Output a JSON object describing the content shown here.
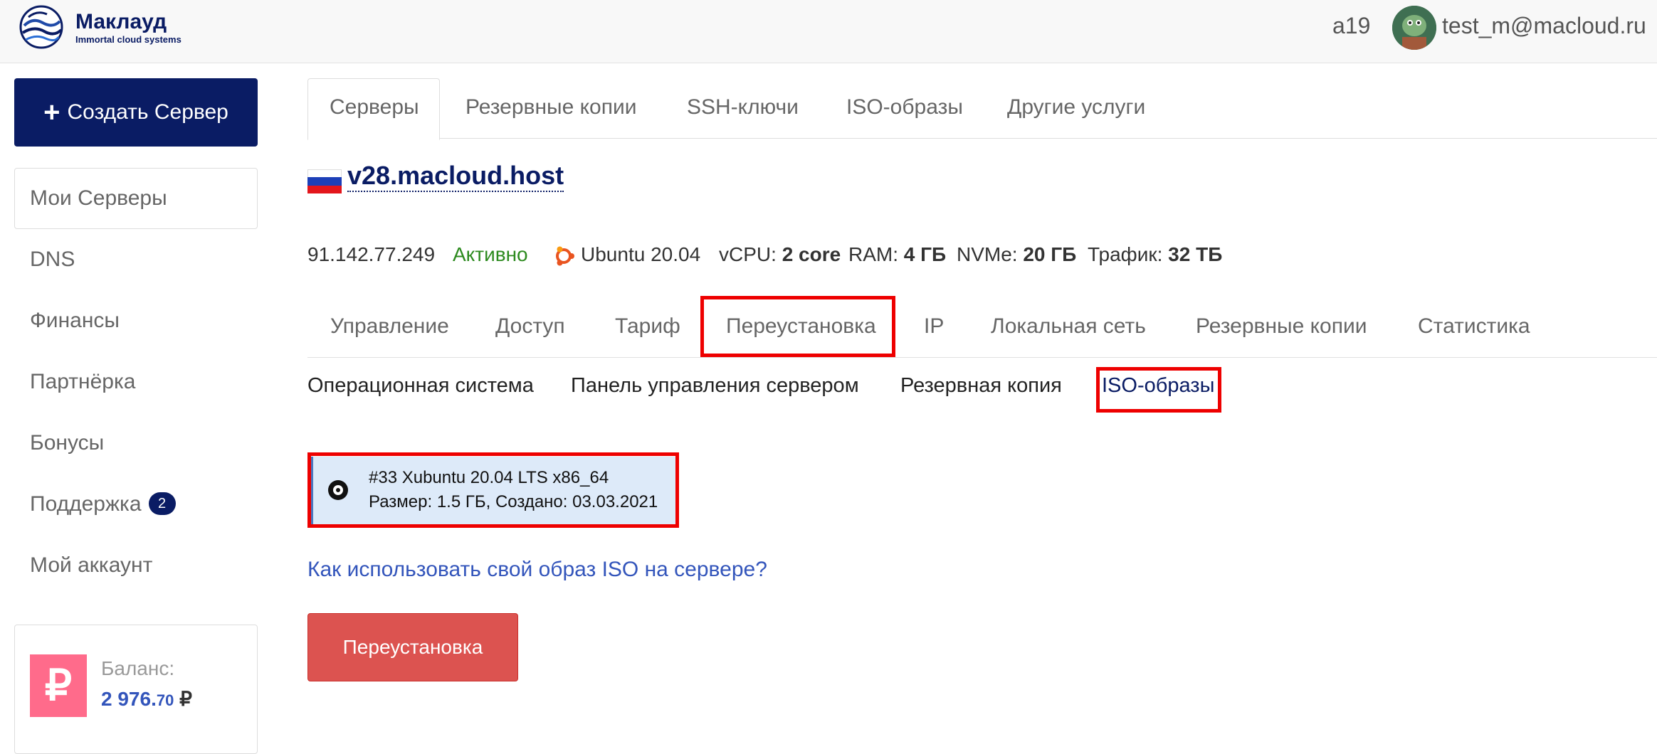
{
  "header": {
    "logo_name": "Маклауд",
    "logo_tagline": "Immortal cloud systems",
    "account_id": "a19",
    "user_email": "test_m@macloud.ru"
  },
  "sidebar": {
    "create_button": "Создать Сервер",
    "items": [
      {
        "label": "Мои Серверы"
      },
      {
        "label": "DNS"
      },
      {
        "label": "Финансы"
      },
      {
        "label": "Партнёрка"
      },
      {
        "label": "Бонусы"
      },
      {
        "label": "Поддержка",
        "badge": "2"
      },
      {
        "label": "Мой аккаунт"
      }
    ],
    "balance": {
      "label": "Баланс:",
      "integer": "2 976.",
      "decimal": "70",
      "currency": "₽",
      "icon": "₽"
    }
  },
  "top_tabs": [
    "Серверы",
    "Резервные копии",
    "SSH-ключи",
    "ISO-образы",
    "Другие услуги"
  ],
  "server": {
    "hostname": "v28.macloud.host",
    "ip": "91.142.77.249",
    "status": "Активно",
    "os": "Ubuntu 20.04",
    "vcpu_label": "vCPU:",
    "vcpu_value": "2 core",
    "ram_label": "RAM:",
    "ram_value": "4 ГБ",
    "nvme_label": "NVMe:",
    "nvme_value": "20 ГБ",
    "traffic_label": "Трафик:",
    "traffic_value": "32 ТБ"
  },
  "sub_tabs": [
    "Управление",
    "Доступ",
    "Тариф",
    "Переустановка",
    "IP",
    "Локальная сеть",
    "Резервные копии",
    "Статистика"
  ],
  "reinstall_options": [
    "Операционная система",
    "Панель управления сервером",
    "Резервная копия",
    "ISO-образы"
  ],
  "iso": {
    "name": "#33 Xubuntu 20.04 LTS x86_64",
    "meta": "Размер: 1.5 ГБ, Создано: 03.03.2021"
  },
  "help_link": "Как использовать свой образ ISO на сервере?",
  "reinstall_button": "Переустановка",
  "colors": {
    "brand": "#0a1c64",
    "highlight": "#ee0000",
    "active_status": "#2c8a1e",
    "danger_button": "#dc5350",
    "link": "#3355bb",
    "balance_icon": "#ff6b8b"
  }
}
